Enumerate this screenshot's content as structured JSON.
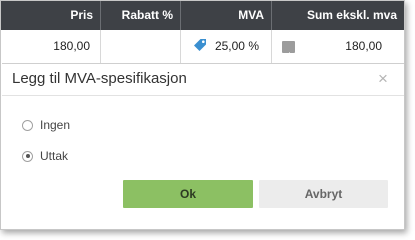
{
  "table": {
    "headers": [
      "Pris",
      "Rabatt %",
      "MVA",
      "Sum ekskl. mva"
    ],
    "row": {
      "pris": "180,00",
      "rabatt": "",
      "mva": "25,00 %",
      "sum": "180,00"
    },
    "tag_icon": "price-tag-icon",
    "arrow_icon": "arrow-right-icon",
    "tag_color": "#3a8fd0"
  },
  "dialog": {
    "title": "Legg til MVA-spesifikasjon",
    "close_label": "×",
    "options": [
      {
        "label": "Ingen",
        "checked": false
      },
      {
        "label": "Uttak",
        "checked": true
      }
    ],
    "ok_label": "Ok",
    "cancel_label": "Avbryt",
    "ok_color": "#8cc063"
  }
}
